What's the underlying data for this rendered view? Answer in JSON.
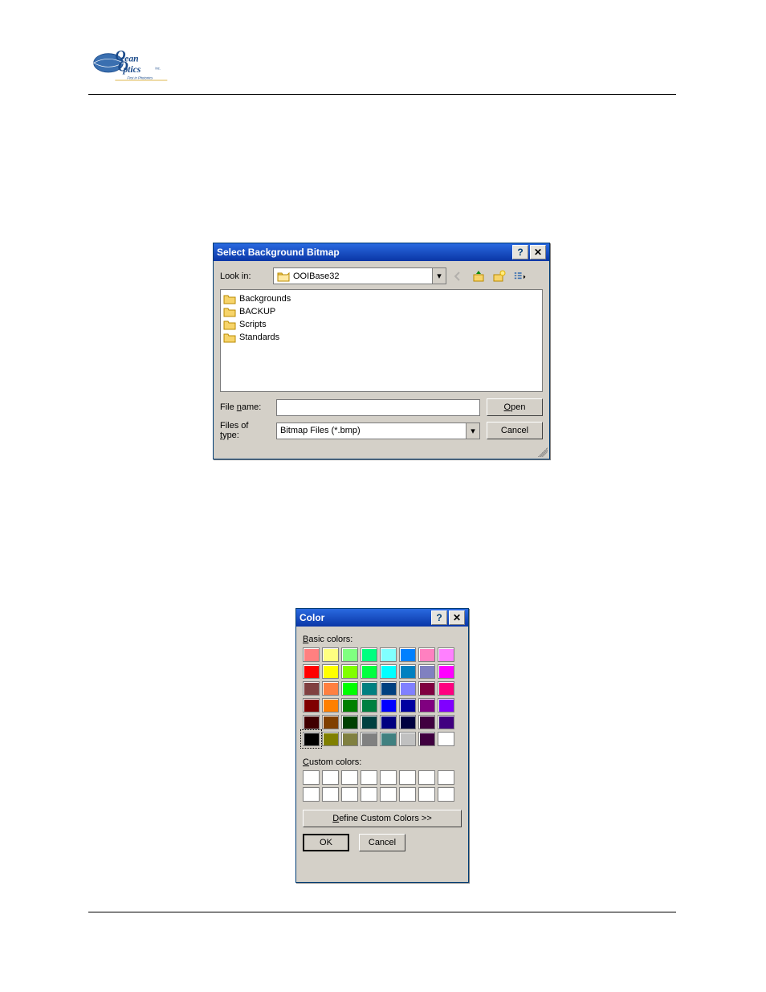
{
  "dialog1": {
    "title": "Select Background Bitmap",
    "help": "?",
    "close": "✕",
    "lookin_label": "Look in:",
    "lookin_value": "OOIBase32",
    "items": [
      "Backgrounds",
      "BACKUP",
      "Scripts",
      "Standards"
    ],
    "filename_label": "File name:",
    "filename_value": "",
    "filetype_label": "Files of type:",
    "filetype_value": "Bitmap Files (*.bmp)",
    "open_label": "Open",
    "cancel_label": "Cancel",
    "toolbar_icons": {
      "back": "back-icon",
      "up": "up-icon",
      "new": "new-folder-icon",
      "view": "view-menu-icon"
    }
  },
  "dialog2": {
    "title": "Color",
    "help": "?",
    "close": "✕",
    "basic_label": "Basic colors:",
    "custom_label": "Custom colors:",
    "define_label": "Define Custom Colors >>",
    "ok_label": "OK",
    "cancel_label": "Cancel",
    "basic_colors": [
      "#ff8080",
      "#ffff80",
      "#80ff80",
      "#00ff80",
      "#80ffff",
      "#0080ff",
      "#ff80c0",
      "#ff80ff",
      "#ff0000",
      "#ffff00",
      "#80ff00",
      "#00ff40",
      "#00ffff",
      "#0080c0",
      "#8080c0",
      "#ff00ff",
      "#804040",
      "#ff8040",
      "#00ff00",
      "#008080",
      "#004080",
      "#8080ff",
      "#800040",
      "#ff0080",
      "#800000",
      "#ff8000",
      "#008000",
      "#008040",
      "#0000ff",
      "#0000a0",
      "#800080",
      "#8000ff",
      "#400000",
      "#804000",
      "#004000",
      "#004040",
      "#000080",
      "#000040",
      "#400040",
      "#400080",
      "#000000",
      "#808000",
      "#808040",
      "#808080",
      "#408080",
      "#c0c0c0",
      "#400040",
      "#ffffff"
    ],
    "selected_index": 40,
    "custom_slots": 16
  }
}
